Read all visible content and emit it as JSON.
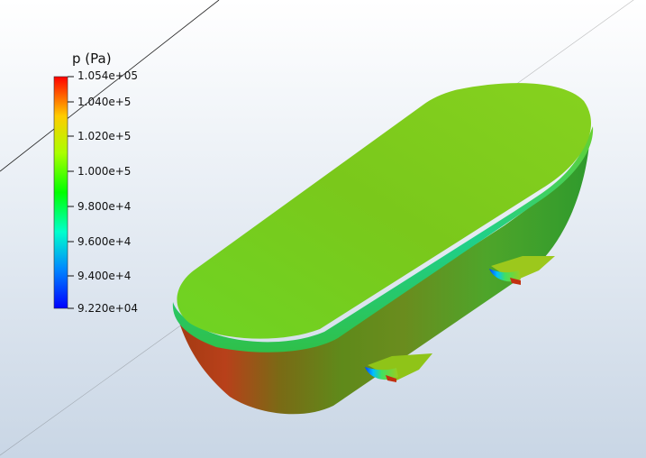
{
  "legend": {
    "title": "p (Pa)",
    "ticks": [
      {
        "label": "1.054e+05",
        "value": 105400
      },
      {
        "label": "1.040e+5",
        "value": 104000
      },
      {
        "label": "1.020e+5",
        "value": 102000
      },
      {
        "label": "1.000e+5",
        "value": 100000
      },
      {
        "label": "9.800e+4",
        "value": 98000
      },
      {
        "label": "9.600e+4",
        "value": 96000
      },
      {
        "label": "9.400e+4",
        "value": 94000
      },
      {
        "label": "9.220e+04",
        "value": 92200
      }
    ],
    "min": 92200,
    "max": 105400,
    "colormap": [
      "#0000ff",
      "#00aaff",
      "#00ffcc",
      "#00ff00",
      "#ffff00",
      "#ff8800",
      "#ff0000"
    ]
  },
  "model": {
    "description_colors": {
      "top_surface": "#7ad31a",
      "side_shadow": "#8a5a10",
      "side_hot": "#c0301a",
      "side_green": "#3aa42a",
      "rim": "#20c060"
    }
  }
}
